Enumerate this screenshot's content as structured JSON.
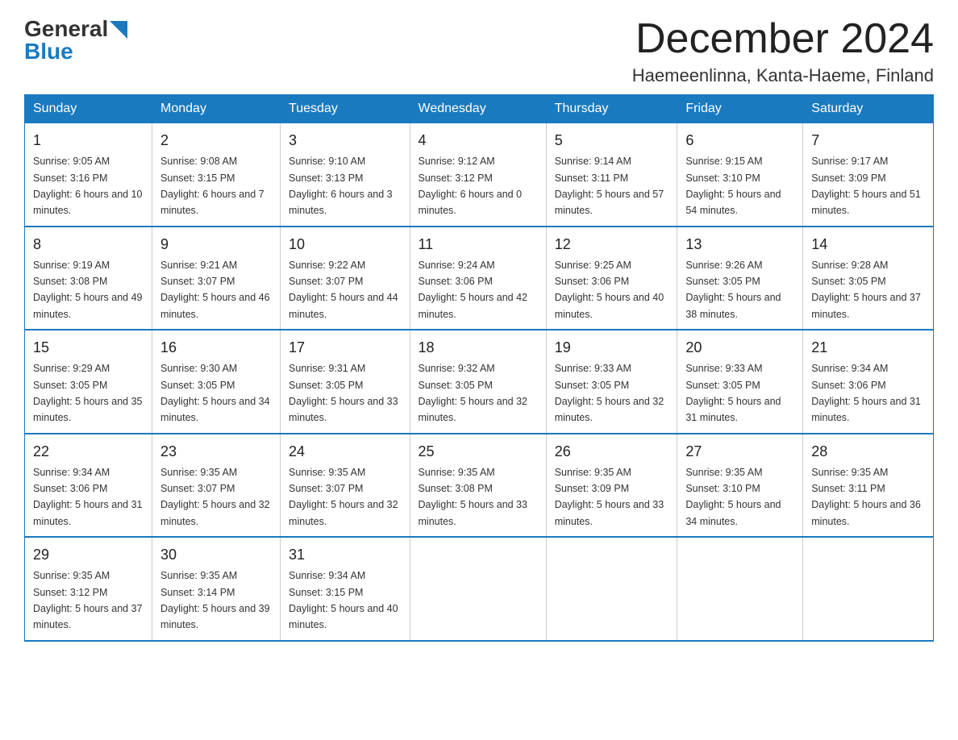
{
  "logo": {
    "text_general": "General",
    "arrow_color": "#1a7abf",
    "text_blue": "Blue"
  },
  "header": {
    "month_year": "December 2024",
    "location": "Haemeenlinna, Kanta-Haeme, Finland"
  },
  "weekdays": [
    "Sunday",
    "Monday",
    "Tuesday",
    "Wednesday",
    "Thursday",
    "Friday",
    "Saturday"
  ],
  "weeks": [
    [
      {
        "day": "1",
        "sunrise": "Sunrise: 9:05 AM",
        "sunset": "Sunset: 3:16 PM",
        "daylight": "Daylight: 6 hours and 10 minutes."
      },
      {
        "day": "2",
        "sunrise": "Sunrise: 9:08 AM",
        "sunset": "Sunset: 3:15 PM",
        "daylight": "Daylight: 6 hours and 7 minutes."
      },
      {
        "day": "3",
        "sunrise": "Sunrise: 9:10 AM",
        "sunset": "Sunset: 3:13 PM",
        "daylight": "Daylight: 6 hours and 3 minutes."
      },
      {
        "day": "4",
        "sunrise": "Sunrise: 9:12 AM",
        "sunset": "Sunset: 3:12 PM",
        "daylight": "Daylight: 6 hours and 0 minutes."
      },
      {
        "day": "5",
        "sunrise": "Sunrise: 9:14 AM",
        "sunset": "Sunset: 3:11 PM",
        "daylight": "Daylight: 5 hours and 57 minutes."
      },
      {
        "day": "6",
        "sunrise": "Sunrise: 9:15 AM",
        "sunset": "Sunset: 3:10 PM",
        "daylight": "Daylight: 5 hours and 54 minutes."
      },
      {
        "day": "7",
        "sunrise": "Sunrise: 9:17 AM",
        "sunset": "Sunset: 3:09 PM",
        "daylight": "Daylight: 5 hours and 51 minutes."
      }
    ],
    [
      {
        "day": "8",
        "sunrise": "Sunrise: 9:19 AM",
        "sunset": "Sunset: 3:08 PM",
        "daylight": "Daylight: 5 hours and 49 minutes."
      },
      {
        "day": "9",
        "sunrise": "Sunrise: 9:21 AM",
        "sunset": "Sunset: 3:07 PM",
        "daylight": "Daylight: 5 hours and 46 minutes."
      },
      {
        "day": "10",
        "sunrise": "Sunrise: 9:22 AM",
        "sunset": "Sunset: 3:07 PM",
        "daylight": "Daylight: 5 hours and 44 minutes."
      },
      {
        "day": "11",
        "sunrise": "Sunrise: 9:24 AM",
        "sunset": "Sunset: 3:06 PM",
        "daylight": "Daylight: 5 hours and 42 minutes."
      },
      {
        "day": "12",
        "sunrise": "Sunrise: 9:25 AM",
        "sunset": "Sunset: 3:06 PM",
        "daylight": "Daylight: 5 hours and 40 minutes."
      },
      {
        "day": "13",
        "sunrise": "Sunrise: 9:26 AM",
        "sunset": "Sunset: 3:05 PM",
        "daylight": "Daylight: 5 hours and 38 minutes."
      },
      {
        "day": "14",
        "sunrise": "Sunrise: 9:28 AM",
        "sunset": "Sunset: 3:05 PM",
        "daylight": "Daylight: 5 hours and 37 minutes."
      }
    ],
    [
      {
        "day": "15",
        "sunrise": "Sunrise: 9:29 AM",
        "sunset": "Sunset: 3:05 PM",
        "daylight": "Daylight: 5 hours and 35 minutes."
      },
      {
        "day": "16",
        "sunrise": "Sunrise: 9:30 AM",
        "sunset": "Sunset: 3:05 PM",
        "daylight": "Daylight: 5 hours and 34 minutes."
      },
      {
        "day": "17",
        "sunrise": "Sunrise: 9:31 AM",
        "sunset": "Sunset: 3:05 PM",
        "daylight": "Daylight: 5 hours and 33 minutes."
      },
      {
        "day": "18",
        "sunrise": "Sunrise: 9:32 AM",
        "sunset": "Sunset: 3:05 PM",
        "daylight": "Daylight: 5 hours and 32 minutes."
      },
      {
        "day": "19",
        "sunrise": "Sunrise: 9:33 AM",
        "sunset": "Sunset: 3:05 PM",
        "daylight": "Daylight: 5 hours and 32 minutes."
      },
      {
        "day": "20",
        "sunrise": "Sunrise: 9:33 AM",
        "sunset": "Sunset: 3:05 PM",
        "daylight": "Daylight: 5 hours and 31 minutes."
      },
      {
        "day": "21",
        "sunrise": "Sunrise: 9:34 AM",
        "sunset": "Sunset: 3:06 PM",
        "daylight": "Daylight: 5 hours and 31 minutes."
      }
    ],
    [
      {
        "day": "22",
        "sunrise": "Sunrise: 9:34 AM",
        "sunset": "Sunset: 3:06 PM",
        "daylight": "Daylight: 5 hours and 31 minutes."
      },
      {
        "day": "23",
        "sunrise": "Sunrise: 9:35 AM",
        "sunset": "Sunset: 3:07 PM",
        "daylight": "Daylight: 5 hours and 32 minutes."
      },
      {
        "day": "24",
        "sunrise": "Sunrise: 9:35 AM",
        "sunset": "Sunset: 3:07 PM",
        "daylight": "Daylight: 5 hours and 32 minutes."
      },
      {
        "day": "25",
        "sunrise": "Sunrise: 9:35 AM",
        "sunset": "Sunset: 3:08 PM",
        "daylight": "Daylight: 5 hours and 33 minutes."
      },
      {
        "day": "26",
        "sunrise": "Sunrise: 9:35 AM",
        "sunset": "Sunset: 3:09 PM",
        "daylight": "Daylight: 5 hours and 33 minutes."
      },
      {
        "day": "27",
        "sunrise": "Sunrise: 9:35 AM",
        "sunset": "Sunset: 3:10 PM",
        "daylight": "Daylight: 5 hours and 34 minutes."
      },
      {
        "day": "28",
        "sunrise": "Sunrise: 9:35 AM",
        "sunset": "Sunset: 3:11 PM",
        "daylight": "Daylight: 5 hours and 36 minutes."
      }
    ],
    [
      {
        "day": "29",
        "sunrise": "Sunrise: 9:35 AM",
        "sunset": "Sunset: 3:12 PM",
        "daylight": "Daylight: 5 hours and 37 minutes."
      },
      {
        "day": "30",
        "sunrise": "Sunrise: 9:35 AM",
        "sunset": "Sunset: 3:14 PM",
        "daylight": "Daylight: 5 hours and 39 minutes."
      },
      {
        "day": "31",
        "sunrise": "Sunrise: 9:34 AM",
        "sunset": "Sunset: 3:15 PM",
        "daylight": "Daylight: 5 hours and 40 minutes."
      },
      null,
      null,
      null,
      null
    ]
  ]
}
